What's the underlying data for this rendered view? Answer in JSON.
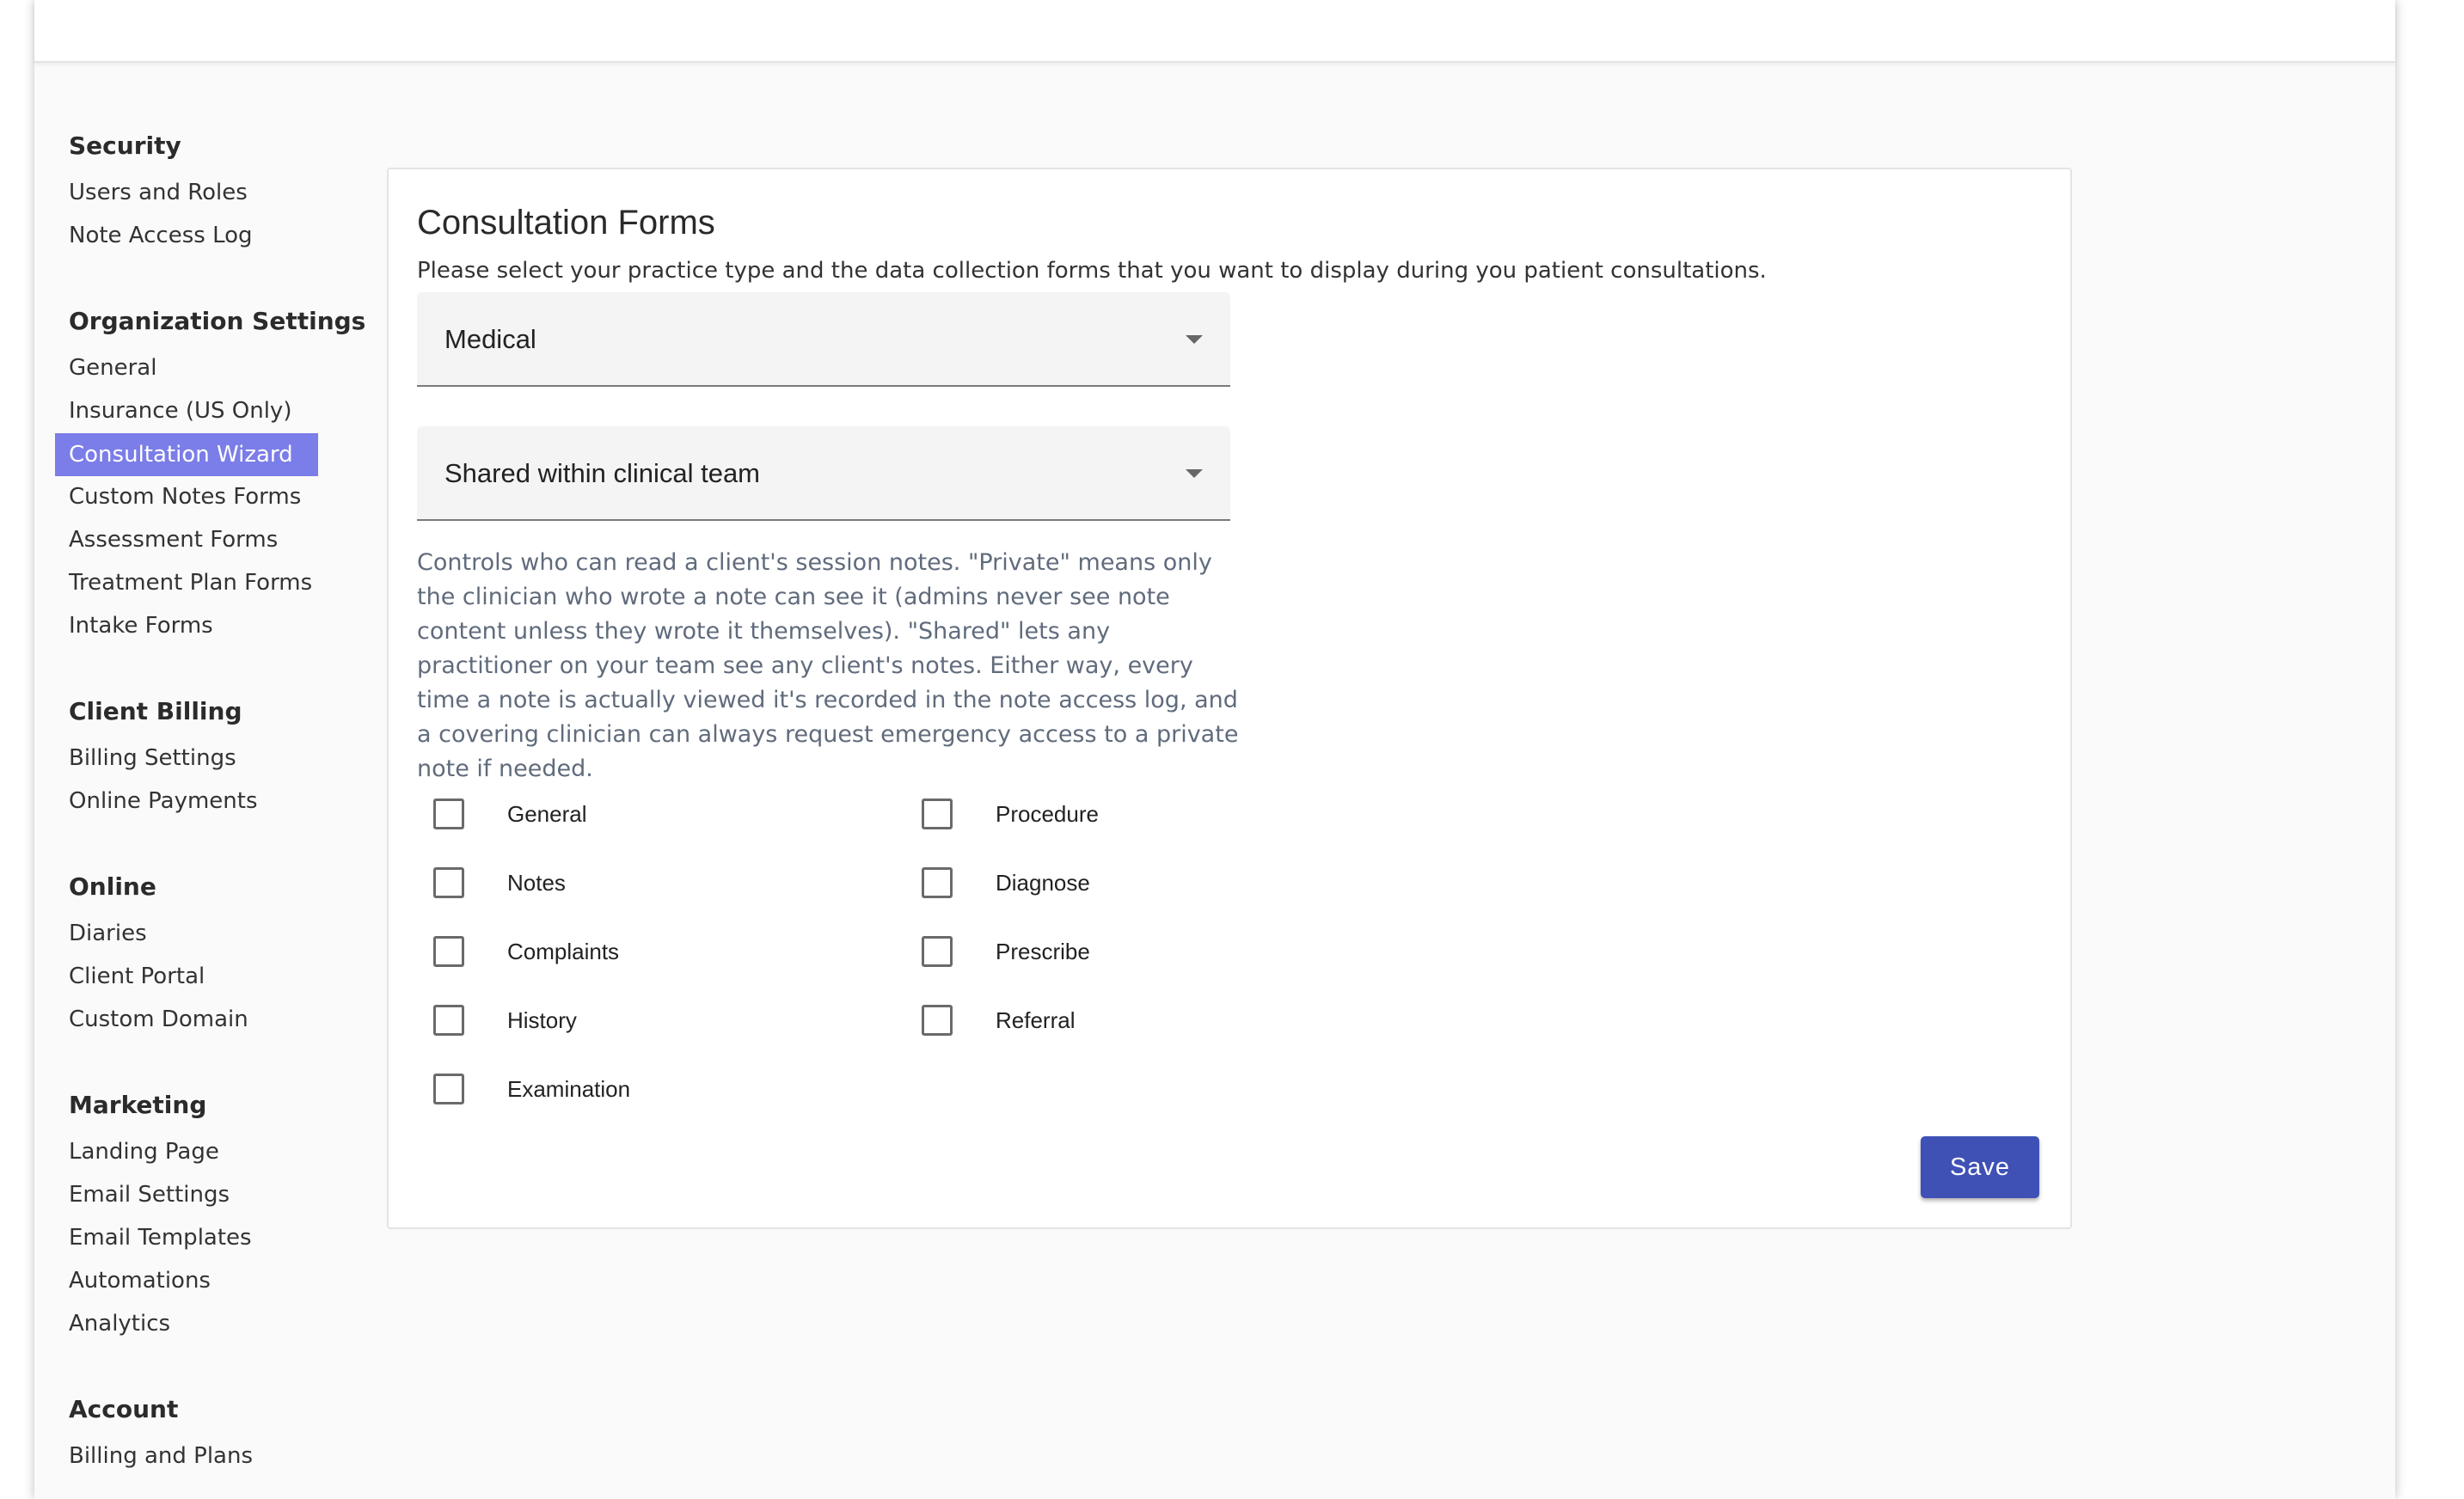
{
  "sidebar": {
    "groups": [
      {
        "heading": "Security",
        "items": [
          "Users and Roles",
          "Note Access Log"
        ]
      },
      {
        "heading": "Organization Settings",
        "items": [
          "General",
          "Insurance (US Only)",
          "Consultation Wizard",
          "Custom Notes Forms",
          "Assessment Forms",
          "Treatment Plan Forms",
          "Intake Forms"
        ]
      },
      {
        "heading": "Client Billing",
        "items": [
          "Billing Settings",
          "Online Payments"
        ]
      },
      {
        "heading": "Online",
        "items": [
          "Diaries",
          "Client Portal",
          "Custom Domain"
        ]
      },
      {
        "heading": "Marketing",
        "items": [
          "Landing Page",
          "Email Settings",
          "Email Templates",
          "Automations",
          "Analytics"
        ]
      },
      {
        "heading": "Account",
        "items": [
          "Billing and Plans"
        ]
      }
    ],
    "active_item": "Consultation Wizard",
    "active_color": "#7b7de8"
  },
  "main": {
    "title": "Consultation Forms",
    "description": "Please select your practice type and the data collection forms that you want to display during you patient consultations.",
    "practice_type_select": {
      "value": "Medical"
    },
    "note_sharing_select": {
      "value": "Shared within clinical team"
    },
    "help_text": "Controls who can read a client's session notes. \"Private\" means only the clinician who wrote a note can see it (admins never see note content unless they wrote it themselves). \"Shared\" lets any practitioner on your team see any client's notes. Either way, every time a note is actually viewed it's recorded in the note access log, and a covering clinician can always request emergency access to a private note if needed.",
    "forms_left": [
      {
        "label": "General",
        "checked": false
      },
      {
        "label": "Notes",
        "checked": false
      },
      {
        "label": "Complaints",
        "checked": false
      },
      {
        "label": "History",
        "checked": false
      },
      {
        "label": "Examination",
        "checked": false
      }
    ],
    "forms_right": [
      {
        "label": "Procedure",
        "checked": false
      },
      {
        "label": "Diagnose",
        "checked": false
      },
      {
        "label": "Prescribe",
        "checked": false
      },
      {
        "label": "Referral",
        "checked": false
      }
    ],
    "save_label": "Save",
    "save_color": "#3f51b5"
  }
}
